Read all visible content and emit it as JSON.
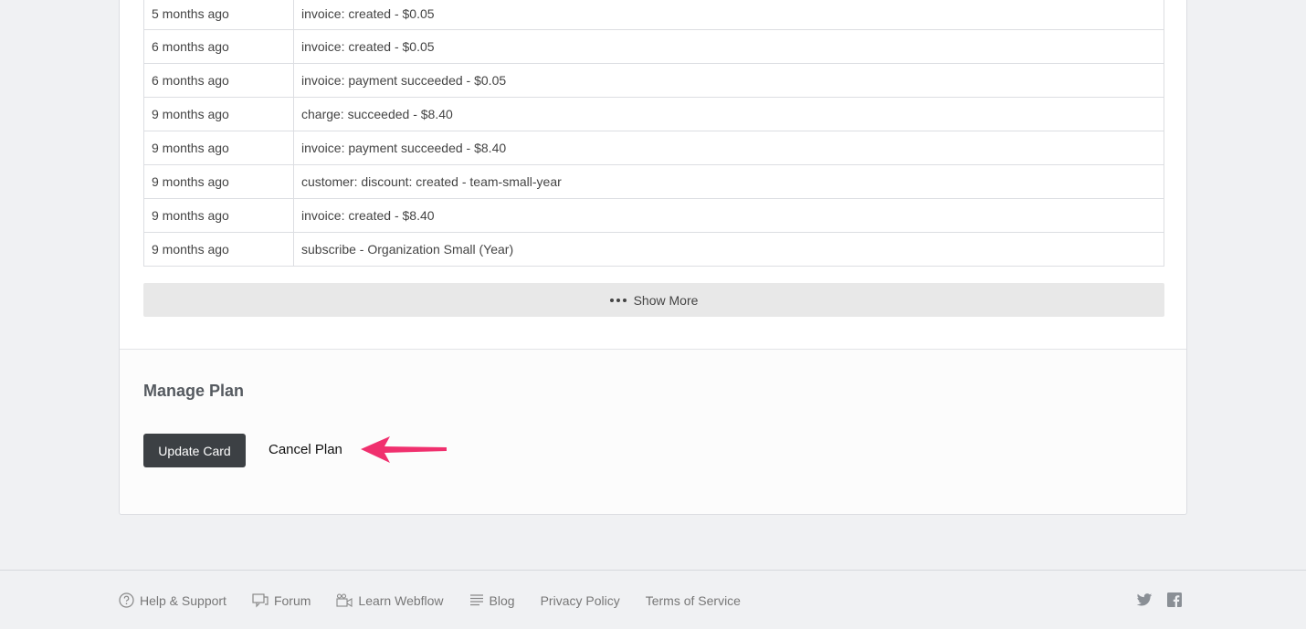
{
  "history": {
    "rows": [
      {
        "date": "5 months ago",
        "event": "invoice: created - $0.05"
      },
      {
        "date": "6 months ago",
        "event": "invoice: created - $0.05"
      },
      {
        "date": "6 months ago",
        "event": "invoice: payment succeeded - $0.05"
      },
      {
        "date": "9 months ago",
        "event": "charge: succeeded - $8.40"
      },
      {
        "date": "9 months ago",
        "event": "invoice: payment succeeded - $8.40"
      },
      {
        "date": "9 months ago",
        "event": "customer: discount: created - team-small-year"
      },
      {
        "date": "9 months ago",
        "event": "invoice: created - $8.40"
      },
      {
        "date": "9 months ago",
        "event": "subscribe - Organization Small (Year)"
      }
    ],
    "show_more_label": "Show More"
  },
  "manage": {
    "title": "Manage Plan",
    "update_card_label": "Update Card",
    "cancel_plan_label": "Cancel Plan"
  },
  "annotation": {
    "arrow_color": "#f0306e"
  },
  "footer": {
    "links": [
      {
        "label": "Help & Support",
        "icon": "question-circle-icon"
      },
      {
        "label": "Forum",
        "icon": "chat-bubbles-icon"
      },
      {
        "label": "Learn Webflow",
        "icon": "video-camera-icon"
      },
      {
        "label": "Blog",
        "icon": "lines-icon"
      },
      {
        "label": "Privacy Policy",
        "icon": ""
      },
      {
        "label": "Terms of Service",
        "icon": ""
      }
    ],
    "social": [
      "twitter-icon",
      "facebook-icon"
    ]
  }
}
